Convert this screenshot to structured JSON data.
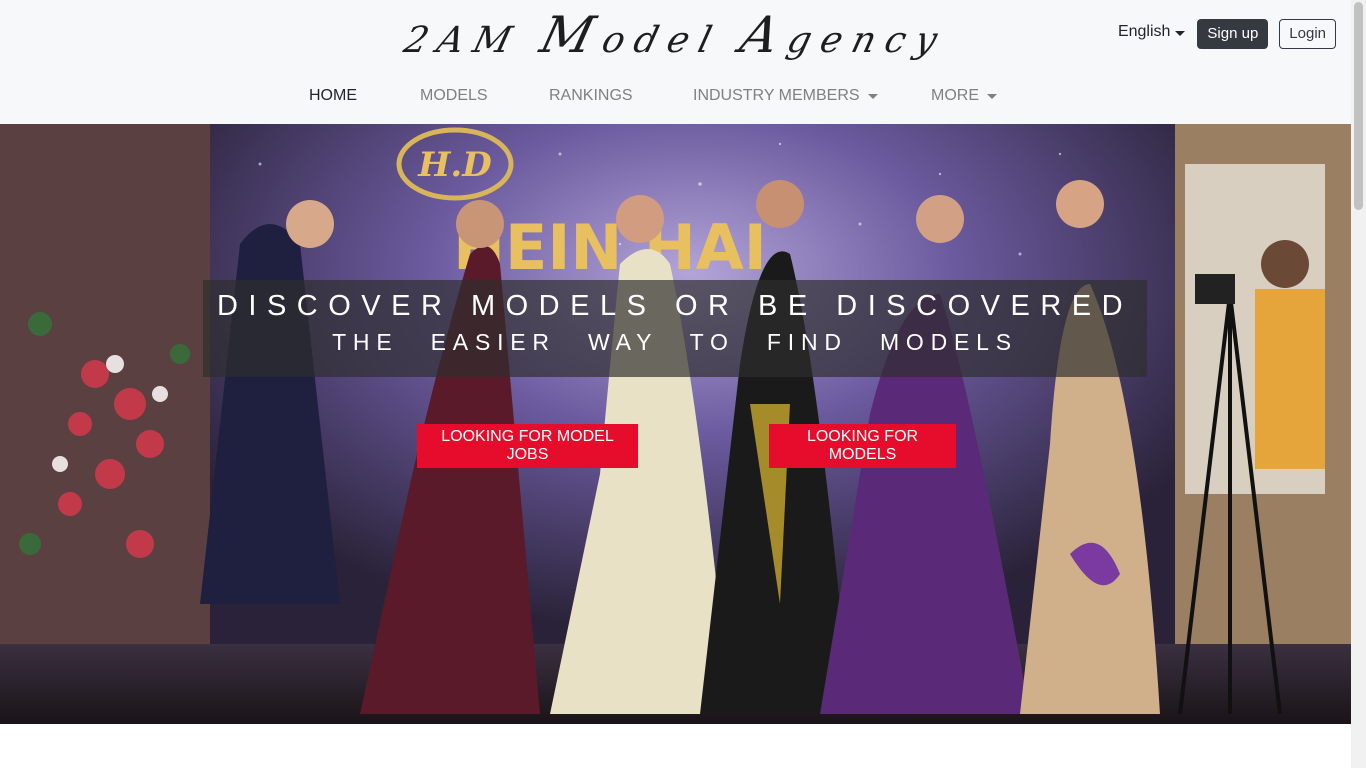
{
  "header": {
    "logo": {
      "p1": "2AM",
      "p2": "M",
      "p3": "odel",
      "p4": "A",
      "p5": "gency"
    },
    "language": "English",
    "signup_label": "Sign up",
    "login_label": "Login"
  },
  "nav": {
    "items": [
      {
        "label": "HOME",
        "active": true
      },
      {
        "label": "MODELS"
      },
      {
        "label": "RANKINGS"
      },
      {
        "label": "INDUSTRY MEMBERS",
        "dropdown": true
      },
      {
        "label": "MORE",
        "dropdown": true
      }
    ]
  },
  "hero": {
    "headline": "DISCOVER MODELS OR BE DISCOVERED",
    "subheadline": "THE EASIER WAY TO FIND MODELS",
    "cta_left": "LOOKING FOR MODEL JOBS",
    "cta_right": "LOOKING FOR MODELS",
    "backdrop_logo": "H.D",
    "backdrop_text": "HEIN HAI"
  },
  "colors": {
    "accent": "#e50d2b",
    "dark": "#343a40",
    "header_bg": "#f7f8f9"
  },
  "icons": [
    "chevron-down-icon"
  ]
}
